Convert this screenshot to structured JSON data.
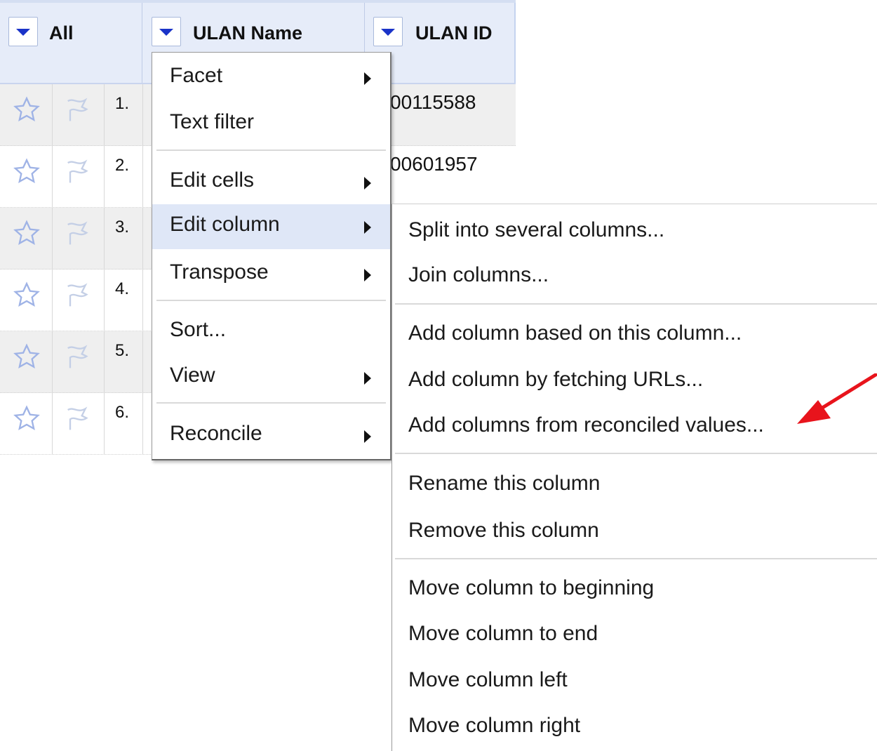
{
  "header": {
    "all_label": "All",
    "name_label": "ULAN Name",
    "id_label": "ULAN ID"
  },
  "rows": [
    {
      "num": "1.",
      "id": "00115588"
    },
    {
      "num": "2.",
      "id": "00601957"
    },
    {
      "num": "3.",
      "id": ""
    },
    {
      "num": "4.",
      "id": ""
    },
    {
      "num": "5.",
      "id": ""
    },
    {
      "num": "6.",
      "id": ""
    }
  ],
  "column_menu": {
    "facet": "Facet",
    "text_filter": "Text filter",
    "edit_cells": "Edit cells",
    "edit_column": "Edit column",
    "transpose": "Transpose",
    "sort": "Sort...",
    "view": "View",
    "reconcile": "Reconcile"
  },
  "edit_column_menu": {
    "split": "Split into several columns...",
    "join": "Join columns...",
    "add_based": "Add column based on this column...",
    "add_fetch": "Add column by fetching URLs...",
    "add_reconciled": "Add columns from reconciled values...",
    "rename": "Rename this column",
    "remove": "Remove this column",
    "move_beginning": "Move column to beginning",
    "move_end": "Move column to end",
    "move_left": "Move column left",
    "move_right": "Move column right"
  },
  "colors": {
    "header_bg": "#e6ecf9",
    "dropdown_arrow": "#1a33c8",
    "active_item_bg": "#dfe7f7",
    "annotation_arrow": "#e8141c"
  }
}
